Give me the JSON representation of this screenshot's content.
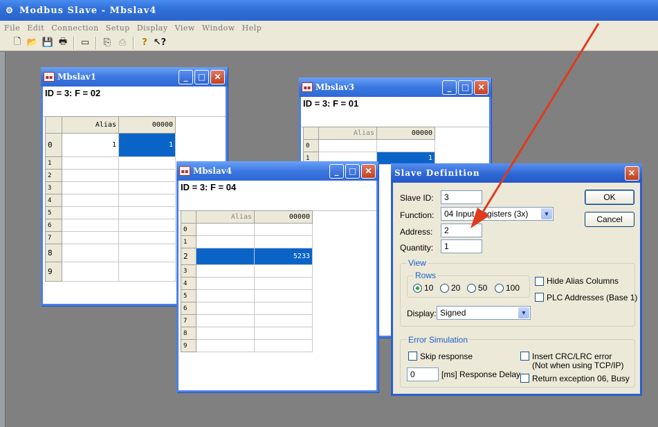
{
  "app": {
    "title": "Modbus Slave - Mbslav4",
    "icon": "app-icon"
  },
  "menu": [
    "File",
    "Edit",
    "Connection",
    "Setup",
    "Display",
    "View",
    "Window",
    "Help"
  ],
  "toolbar": {
    "icons": [
      "new-icon",
      "open-icon",
      "save-icon",
      "print-icon",
      "window-icon",
      "connect-icon",
      "disconnect-icon",
      "help-icon",
      "context-help-icon"
    ]
  },
  "windows": {
    "w1": {
      "title": "Mbslav1",
      "id_line": "ID = 3: F = 02",
      "columns": [
        "Alias",
        "00000"
      ],
      "rows": [
        {
          "h": "0",
          "alias": "1",
          "value": "1"
        },
        {
          "h": "1",
          "alias": "",
          "value": ""
        },
        {
          "h": "2",
          "alias": "",
          "value": ""
        },
        {
          "h": "3",
          "alias": "",
          "value": ""
        },
        {
          "h": "4",
          "alias": "",
          "value": ""
        },
        {
          "h": "5",
          "alias": "",
          "value": ""
        },
        {
          "h": "6",
          "alias": "",
          "value": ""
        },
        {
          "h": "7",
          "alias": "",
          "value": ""
        },
        {
          "h": "8",
          "alias": "",
          "value": ""
        },
        {
          "h": "9",
          "alias": "",
          "value": ""
        }
      ]
    },
    "w3": {
      "title": "Mbslav3",
      "id_line": "ID = 3: F = 01",
      "columns": [
        "Alias",
        "00000"
      ],
      "rows": [
        {
          "h": "0",
          "alias": "",
          "value": ""
        },
        {
          "h": "1",
          "alias": "",
          "value": "1"
        }
      ]
    },
    "w4": {
      "title": "Mbslav4",
      "id_line": "ID = 3: F = 04",
      "columns": [
        "Alias",
        "00000"
      ],
      "rows": [
        {
          "h": "0",
          "alias": "",
          "value": ""
        },
        {
          "h": "1",
          "alias": "",
          "value": ""
        },
        {
          "h": "2",
          "alias": "",
          "value": "5233"
        },
        {
          "h": "3",
          "alias": "",
          "value": ""
        },
        {
          "h": "4",
          "alias": "",
          "value": ""
        },
        {
          "h": "5",
          "alias": "",
          "value": ""
        },
        {
          "h": "6",
          "alias": "",
          "value": ""
        },
        {
          "h": "7",
          "alias": "",
          "value": ""
        },
        {
          "h": "8",
          "alias": "",
          "value": ""
        },
        {
          "h": "9",
          "alias": "",
          "value": ""
        }
      ]
    }
  },
  "dialog": {
    "title": "Slave Definition",
    "slave_id_label": "Slave ID:",
    "slave_id": "3",
    "function_label": "Function:",
    "function": "04 Input Registers (3x)",
    "address_label": "Address:",
    "address": "2",
    "quantity_label": "Quantity:",
    "quantity": "1",
    "ok": "OK",
    "cancel": "Cancel",
    "view_caption": "View",
    "rows_caption": "Rows",
    "rows_options": [
      "10",
      "20",
      "50",
      "100"
    ],
    "rows_selected": "10",
    "hide_alias": "Hide Alias Columns",
    "plc_addresses": "PLC Addresses (Base 1)",
    "display_label": "Display:",
    "display": "Signed",
    "error_caption": "Error Simulation",
    "skip_response": "Skip response",
    "insert_crc": "Insert CRC/LRC error",
    "insert_crc_note": "(Not when using TCP/IP)",
    "response_delay_value": "0",
    "response_delay_label": "[ms] Response Delay",
    "return_exception": "Return exception 06, Busy"
  },
  "colors": {
    "selection": "#0a64c8",
    "titlebar": "#2e68d4",
    "annotation_arrow": "#e03a1e"
  }
}
